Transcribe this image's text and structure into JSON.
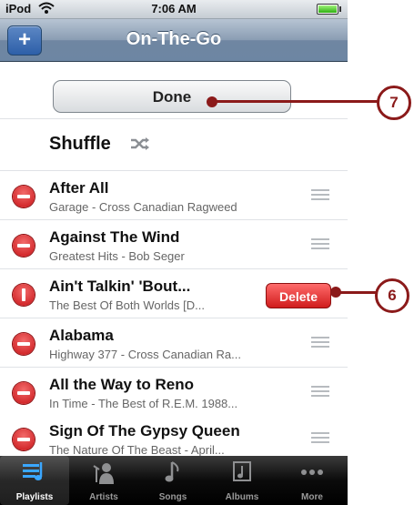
{
  "status": {
    "carrier": "iPod",
    "time": "7:06 AM",
    "wifi_icon": "wifi-icon",
    "battery_icon": "battery-icon"
  },
  "nav": {
    "title": "On-The-Go",
    "add_label": "+"
  },
  "done_label": "Done",
  "shuffle_label": "Shuffle",
  "tracks": [
    {
      "title": "After All",
      "subtitle": "Garage - Cross Canadian Ragweed"
    },
    {
      "title": "Against The Wind",
      "subtitle": "Greatest Hits - Bob Seger"
    },
    {
      "title": "Ain't Talkin' 'Bout...",
      "subtitle": "The Best Of Both Worlds [D...",
      "delete_label": "Delete"
    },
    {
      "title": "Alabama",
      "subtitle": "Highway 377 - Cross Canadian Ra..."
    },
    {
      "title": "All the Way to Reno",
      "subtitle": "In Time - The Best of R.E.M. 1988..."
    },
    {
      "title": "Sign Of The Gypsy Queen",
      "subtitle": "The Nature Of The Beast - April..."
    }
  ],
  "tabs": [
    {
      "label": "Playlists",
      "icon": "playlists-icon",
      "active": true
    },
    {
      "label": "Artists",
      "icon": "artists-icon"
    },
    {
      "label": "Songs",
      "icon": "songs-icon"
    },
    {
      "label": "Albums",
      "icon": "albums-icon"
    },
    {
      "label": "More",
      "icon": "more-icon"
    }
  ],
  "callouts": {
    "done": "7",
    "delete": "6"
  },
  "colors": {
    "callout": "#8b1a1a",
    "delete": "#d01c1c",
    "nav": "#6d86a3"
  }
}
